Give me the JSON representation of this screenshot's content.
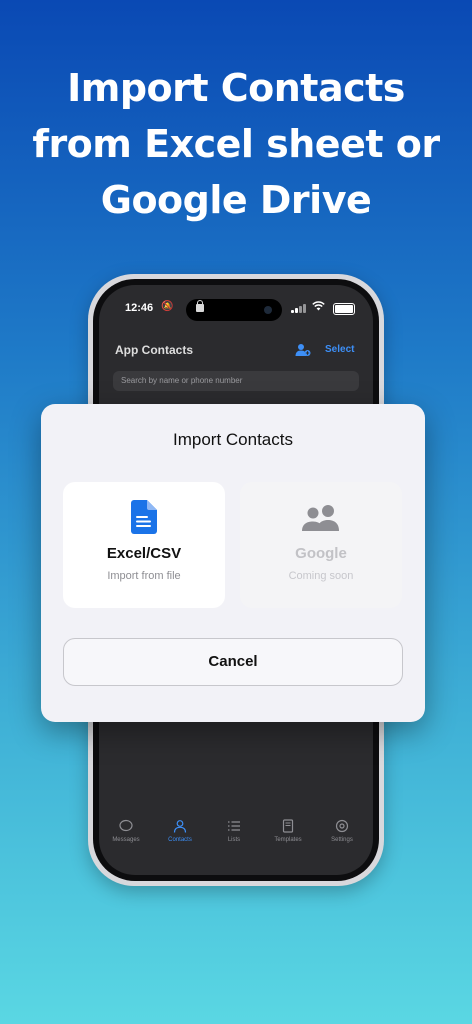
{
  "headline": "Import Contacts from Excel sheet or Google Drive",
  "phone": {
    "status": {
      "time": "12:46"
    },
    "appbar": {
      "title": "App Contacts",
      "select_label": "Select"
    },
    "search": {
      "placeholder": "Search by name or phone number"
    },
    "tabs": [
      {
        "label": "Messages",
        "icon": "chat-bubble-icon",
        "active": false
      },
      {
        "label": "Contacts",
        "icon": "person-icon",
        "active": true
      },
      {
        "label": "Lists",
        "icon": "list-icon",
        "active": false
      },
      {
        "label": "Templates",
        "icon": "document-icon",
        "active": false
      },
      {
        "label": "Settings",
        "icon": "gear-icon",
        "active": false
      }
    ]
  },
  "modal": {
    "title": "Import Contacts",
    "options": [
      {
        "name": "Excel/CSV",
        "subtitle": "Import from file",
        "icon": "file-icon",
        "enabled": true
      },
      {
        "name": "Google",
        "subtitle": "Coming soon",
        "icon": "people-icon",
        "enabled": false
      }
    ],
    "cancel_label": "Cancel"
  },
  "colors": {
    "accent": "#1a73e8",
    "select_blue": "#3d8ff7",
    "gradient_top": "#0a49b4",
    "gradient_bottom": "#5ad7e3"
  }
}
